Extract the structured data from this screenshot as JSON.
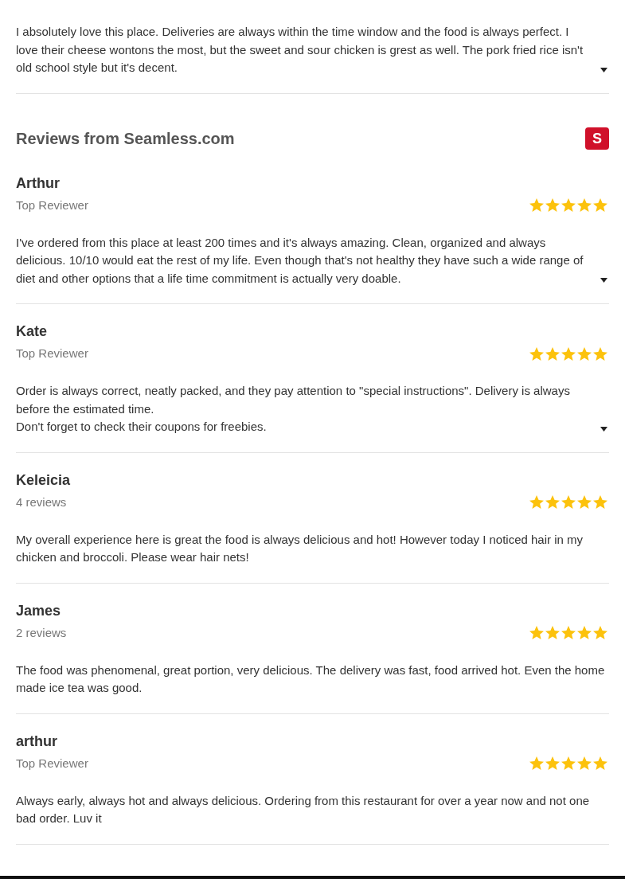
{
  "top_review": {
    "text": "I absolutely love this place. Deliveries are always within the time window and the food is always perfect. I love their cheese wontons the most, but the sweet and sour chicken is grest as well. The pork fried rice isn't old school style but it's decent.",
    "expandable": true
  },
  "section": {
    "title": "Reviews from Seamless.com",
    "logo_text": "S"
  },
  "reviews": [
    {
      "name": "Arthur",
      "meta": "Top Reviewer",
      "stars": 5,
      "text": "I've ordered from this place at least 200 times and it's always amazing. Clean, organized and always delicious. 10/10 would eat the rest of my life. Even though that's not healthy they have such a wide range of diet and other options that a life time commitment is actually very doable.",
      "expandable": true
    },
    {
      "name": "Kate",
      "meta": "Top Reviewer",
      "stars": 5,
      "text": "Order is always correct, neatly packed, and they pay attention to \"special instructions\". Delivery is always before the estimated time.\nDon't forget to check their coupons for freebies.",
      "expandable": true
    },
    {
      "name": "Keleicia",
      "meta": "4 reviews",
      "stars": 5,
      "text": "My overall experience here is great the food is always delicious and hot! However today I noticed hair in my chicken and broccoli. Please wear hair nets!",
      "expandable": false
    },
    {
      "name": "James",
      "meta": "2 reviews",
      "stars": 5,
      "text": "The food was phenomenal, great portion, very delicious. The delivery was fast, food arrived hot. Even the home made ice tea was good.",
      "expandable": false
    },
    {
      "name": "arthur",
      "meta": "Top Reviewer",
      "stars": 5,
      "text": "Always early, always hot and always delicious. Ordering from this restaurant for over a year now and not one bad order. Luv it",
      "expandable": false
    }
  ]
}
